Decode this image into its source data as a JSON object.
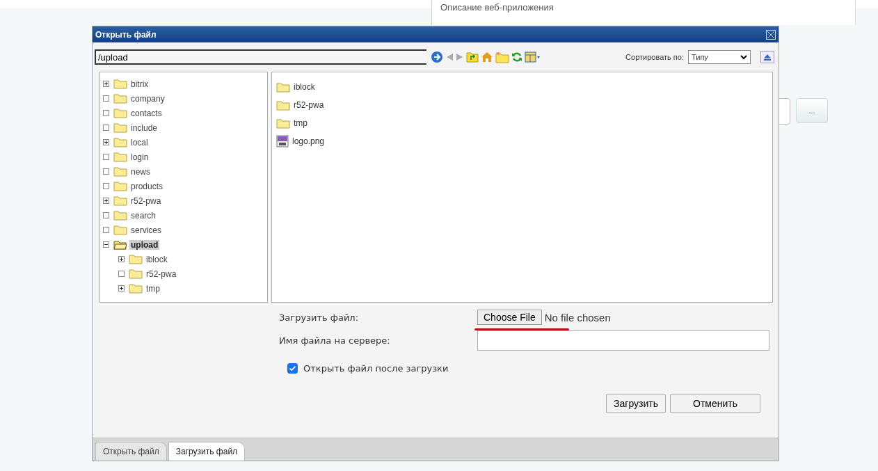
{
  "background": {
    "description": "Описание веб-приложения",
    "browse_button": "..."
  },
  "dialog": {
    "title": "Открыть файл",
    "path": "/upload",
    "sort_label": "Сортировать по:",
    "sort_value": "Типу",
    "tree": [
      {
        "name": "bitrix",
        "kind": "collapsed",
        "selected": false
      },
      {
        "name": "company",
        "kind": "leaf",
        "selected": false
      },
      {
        "name": "contacts",
        "kind": "leaf",
        "selected": false
      },
      {
        "name": "include",
        "kind": "leaf",
        "selected": false
      },
      {
        "name": "local",
        "kind": "collapsed",
        "selected": false
      },
      {
        "name": "login",
        "kind": "leaf",
        "selected": false
      },
      {
        "name": "news",
        "kind": "leaf",
        "selected": false
      },
      {
        "name": "products",
        "kind": "leaf",
        "selected": false
      },
      {
        "name": "r52-pwa",
        "kind": "collapsed",
        "selected": false
      },
      {
        "name": "search",
        "kind": "leaf",
        "selected": false
      },
      {
        "name": "services",
        "kind": "leaf",
        "selected": false
      },
      {
        "name": "upload",
        "kind": "expanded",
        "selected": true,
        "children": [
          {
            "name": "iblock",
            "kind": "collapsed",
            "selected": false
          },
          {
            "name": "r52-pwa",
            "kind": "leaf",
            "selected": false
          },
          {
            "name": "tmp",
            "kind": "collapsed",
            "selected": false
          }
        ]
      }
    ],
    "files": [
      {
        "name": "iblock",
        "kind": "folder"
      },
      {
        "name": "r52-pwa",
        "kind": "folder"
      },
      {
        "name": "tmp",
        "kind": "folder"
      },
      {
        "name": "logo.png",
        "kind": "image"
      }
    ],
    "upload": {
      "file_label": "Загрузить файл:",
      "choose_button": "Choose File",
      "no_file": "No file chosen",
      "server_name_label": "Имя файла на сервере:",
      "open_after": {
        "label": "Открыть файл после загрузки",
        "checked": true
      }
    },
    "buttons": [
      "Загрузить",
      "Отменить"
    ],
    "tabs": [
      {
        "label": "Открыть файл",
        "selected": false
      },
      {
        "label": "Загрузить файл",
        "selected": true
      }
    ]
  }
}
